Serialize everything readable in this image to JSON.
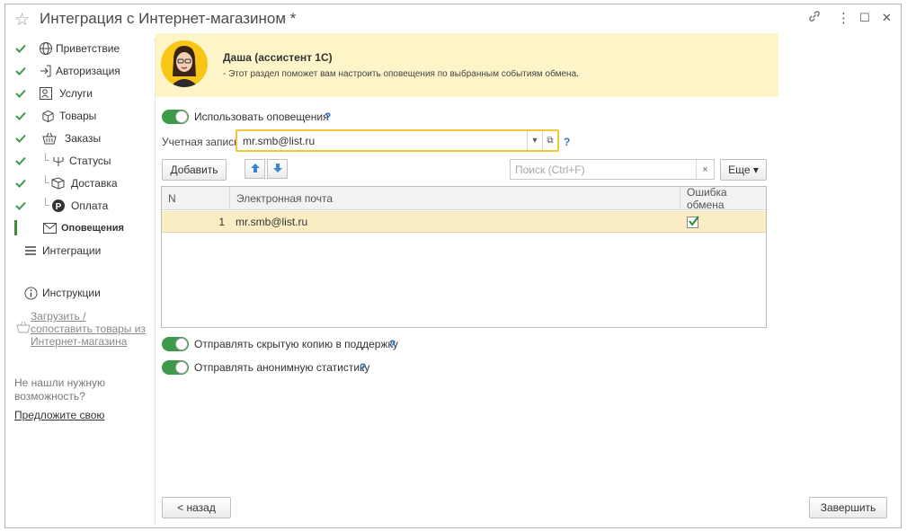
{
  "window": {
    "title": "Интеграция с Интернет-магазином *",
    "star_icon": "☆",
    "link_icon": "🔗",
    "menu_icon": "⋮",
    "maximize_icon": "☐",
    "close_icon": "✕"
  },
  "sidebar": {
    "items": [
      {
        "label": "Приветствие",
        "icon": "globe-icon",
        "done": true
      },
      {
        "label": "Авторизация",
        "icon": "login-icon",
        "done": true
      },
      {
        "label": "Услуги",
        "icon": "services-icon",
        "done": true
      },
      {
        "label": "Товары",
        "icon": "box-icon",
        "done": true
      },
      {
        "label": "Заказы",
        "icon": "basket-icon",
        "done": true
      },
      {
        "label": "Статусы",
        "icon": "status-icon",
        "done": true
      },
      {
        "label": "Доставка",
        "icon": "delivery-icon",
        "done": true
      },
      {
        "label": "Оплата",
        "icon": "payment-icon",
        "done": true
      },
      {
        "label": "Оповещения",
        "icon": "envelope-icon",
        "done": false,
        "active": true
      },
      {
        "label": "Интеграции",
        "icon": "list-icon",
        "done": false
      }
    ],
    "instructions_label": "Инструкции",
    "upload_link_line1": "Загрузить /",
    "upload_link_line2": "сопоставить товары из",
    "upload_link_line3": "Интернет-магазина",
    "not_found_line1": "Не нашли нужную",
    "not_found_line2": "возможность?",
    "suggest_link": "Предложите свою"
  },
  "assistant": {
    "name": "Даша (ассистент 1С)",
    "message": "- Этот раздел поможет вам  настроить оповещения по выбранным событиям обмена."
  },
  "use_notifications": {
    "label": "Использовать оповещения",
    "on": true
  },
  "account": {
    "label": "Учетная запись:",
    "value": "mr.smb@list.ru",
    "dropdown_icon": "▾",
    "open_icon": "⧉"
  },
  "toolbar": {
    "add_label": "Добавить",
    "up_icon": "arrow-up-icon",
    "down_icon": "arrow-down-icon",
    "search_placeholder": "Поиск (Ctrl+F)",
    "search_clear": "×",
    "more_label": "Еще ▾"
  },
  "table": {
    "columns": [
      "N",
      "Электронная почта",
      "Ошибка обмена"
    ],
    "rows": [
      {
        "n": "1",
        "email": "mr.smb@list.ru",
        "error": true
      }
    ]
  },
  "options": [
    {
      "label": "Отправлять скрытую копию в поддержку",
      "on": true
    },
    {
      "label": "Отправлять анонимную статистику",
      "on": true
    }
  ],
  "help_mark": "?",
  "footer": {
    "back_label": "< назад",
    "finish_label": "Завершить"
  },
  "colors": {
    "accent_green": "#3d9a4a",
    "highlight_yellow": "#f4c73a",
    "assistant_bg": "#fdf5c8",
    "row_selected": "#faedc4"
  }
}
